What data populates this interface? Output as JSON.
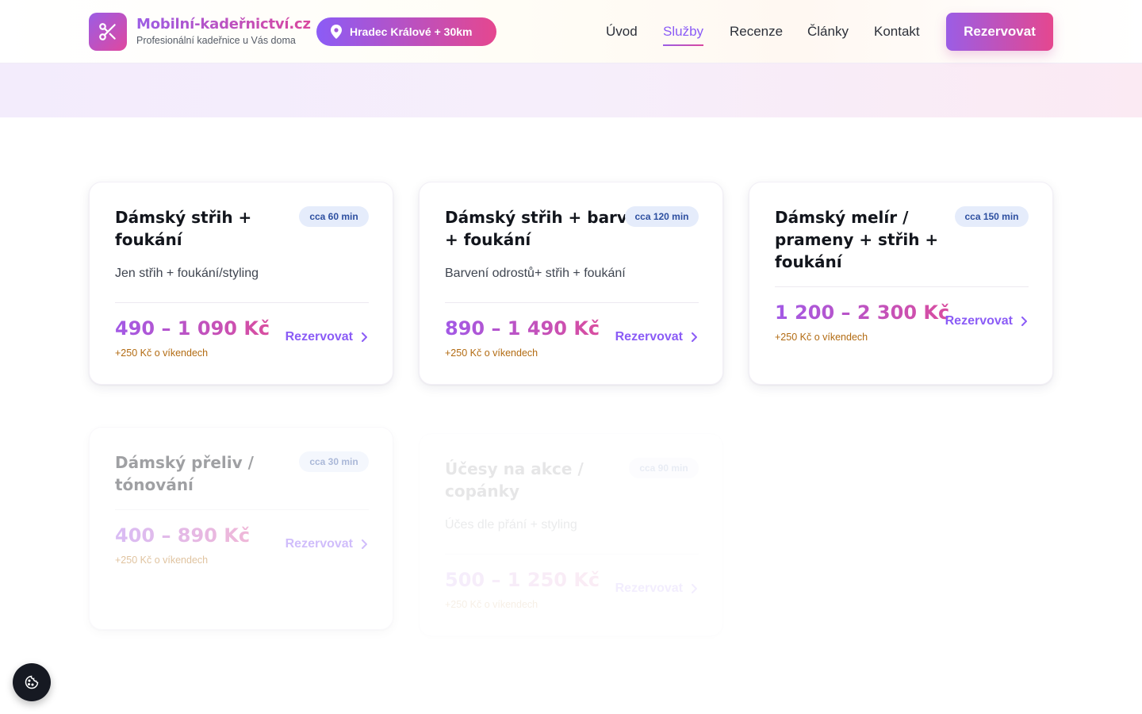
{
  "header": {
    "brand_name": "Mobilní-kadeřnictví.cz",
    "brand_subtitle": "Profesionální kadeřnice u Vás doma",
    "location": "Hradec Králové + 30km",
    "nav": [
      {
        "label": "Úvod",
        "active": false
      },
      {
        "label": "Služby",
        "active": true
      },
      {
        "label": "Recenze",
        "active": false
      },
      {
        "label": "Články",
        "active": false
      },
      {
        "label": "Kontakt",
        "active": false
      }
    ],
    "cta_label": "Rezervovat"
  },
  "services": [
    {
      "title_lines": [
        "Dámský střih +",
        "foukání"
      ],
      "duration": "cca 60 min",
      "description": "Jen střih + foukání/styling",
      "price": "490 – 1 090 Kč",
      "weekend_note": "+250 Kč o víkendech",
      "book_label": "Rezervovat"
    },
    {
      "title_lines": [
        "Dámský střih + barva",
        "+ foukání"
      ],
      "duration": "cca 120 min",
      "description": "Barvení odrostů+ střih + foukání",
      "price": "890 – 1 490 Kč",
      "weekend_note": "+250 Kč o víkendech",
      "book_label": "Rezervovat"
    },
    {
      "title_lines": [
        "Dámský melír /",
        "prameny + střih +",
        "foukání"
      ],
      "duration": "cca 150 min",
      "description": "",
      "price": "1 200 – 2 300 Kč",
      "weekend_note": "+250 Kč o víkendech",
      "book_label": "Rezervovat"
    },
    {
      "title_lines": [
        "Dámský přeliv /",
        "tónování"
      ],
      "duration": "cca 30 min",
      "description": "",
      "price": "400 – 890 Kč",
      "weekend_note": "+250 Kč o víkendech",
      "book_label": "Rezervovat"
    },
    {
      "title_lines": [
        "Účesy na akce /",
        "copánky"
      ],
      "duration": "cca 90 min",
      "description": "Účes dle přání + styling",
      "price": "500 – 1 250 Kč",
      "weekend_note": "+250 Kč o víkendech",
      "book_label": "Rezervovat"
    }
  ],
  "colors": {
    "accent_purple": "#8b5cf6",
    "accent_pink": "#e5478f",
    "badge_bg": "#e5ecfb",
    "badge_text": "#2d4fa0",
    "weekend_note": "#b26b12"
  },
  "icons": {
    "logo": "scissors-icon",
    "location": "map-pin-icon",
    "book_link": "chevron-right-icon",
    "cookie": "cookie-icon"
  }
}
